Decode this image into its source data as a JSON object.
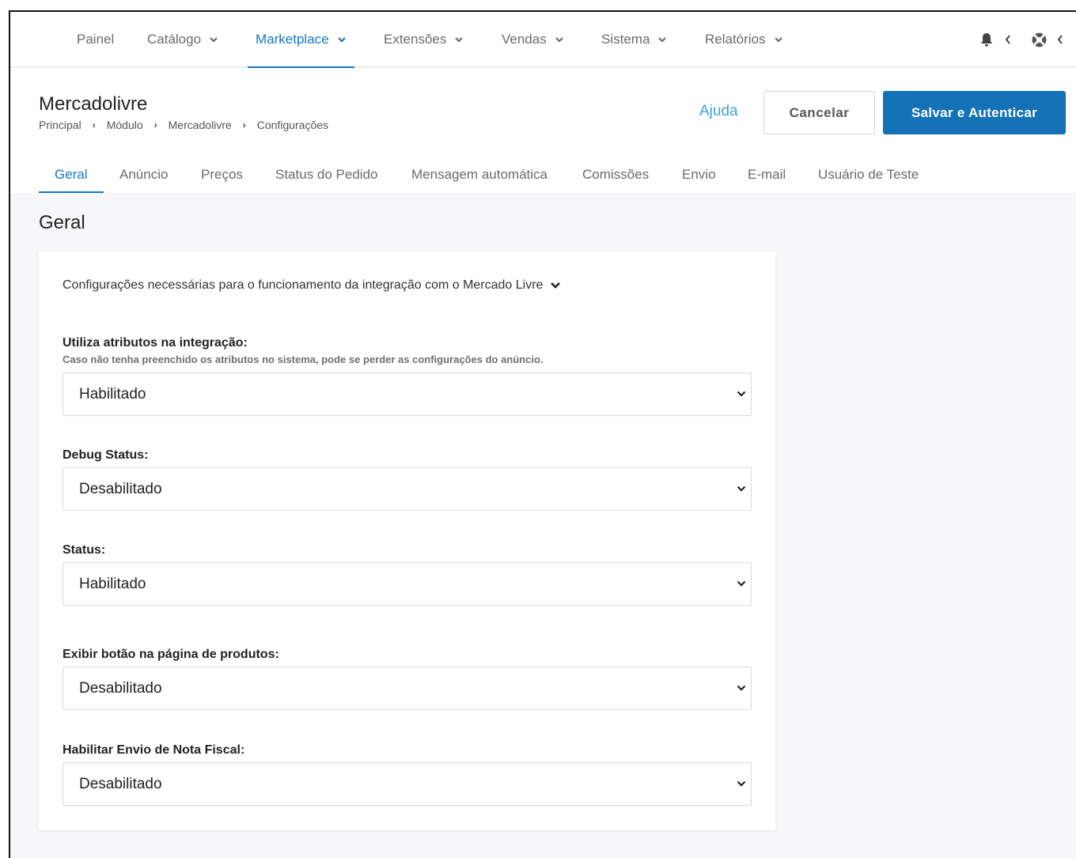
{
  "nav": {
    "items": [
      {
        "label": "Painel",
        "has_dropdown": false,
        "active": false
      },
      {
        "label": "Catálogo",
        "has_dropdown": true,
        "active": false
      },
      {
        "label": "Marketplace",
        "has_dropdown": true,
        "active": true
      },
      {
        "label": "Extensões",
        "has_dropdown": true,
        "active": false
      },
      {
        "label": "Vendas",
        "has_dropdown": true,
        "active": false
      },
      {
        "label": "Sistema",
        "has_dropdown": true,
        "active": false
      },
      {
        "label": "Relatórios",
        "has_dropdown": true,
        "active": false
      }
    ],
    "icons": [
      "bell-icon",
      "chevron-left-icon",
      "lifebuoy-icon",
      "chevron-left-icon"
    ]
  },
  "header": {
    "title": "Mercadolivre",
    "breadcrumb": [
      "Principal",
      "Módulo",
      "Mercadolivre",
      "Configurações"
    ],
    "help_label": "Ajuda",
    "cancel_label": "Cancelar",
    "save_label": "Salvar e Autenticar"
  },
  "tabs": [
    {
      "label": "Geral",
      "active": true
    },
    {
      "label": "Anúncio",
      "active": false
    },
    {
      "label": "Preços",
      "active": false
    },
    {
      "label": "Status do Pedido",
      "active": false
    },
    {
      "label": "Mensagem automática",
      "active": false
    },
    {
      "label": "Comissões",
      "active": false
    },
    {
      "label": "Envio",
      "active": false
    },
    {
      "label": "E-mail",
      "active": false
    },
    {
      "label": "Usuário de Teste",
      "active": false
    }
  ],
  "section": {
    "title": "Geral",
    "intro": "Configurações necessárias para o funcionamento da integração com o Mercado Livre",
    "fields": [
      {
        "label": "Utiliza atributos na integração:",
        "help": "Caso não tenha preenchido os atributos no sistema, pode se perder as configurações do anúncio.",
        "value": "Habilitado"
      },
      {
        "label": "Debug Status:",
        "help": "",
        "value": "Desabilitado"
      },
      {
        "label": "Status:",
        "help": "",
        "value": "Habilitado"
      },
      {
        "label": "Exibir botão na página de produtos:",
        "help": "",
        "value": "Desabilitado"
      },
      {
        "label": "Habilitar Envio de Nota Fiscal:",
        "help": "",
        "value": "Desabilitado"
      }
    ]
  },
  "colors": {
    "accent": "#1478c4",
    "primary_button": "#1472b7",
    "help_link": "#3aa3d8",
    "page_background": "#f6f7f8"
  }
}
